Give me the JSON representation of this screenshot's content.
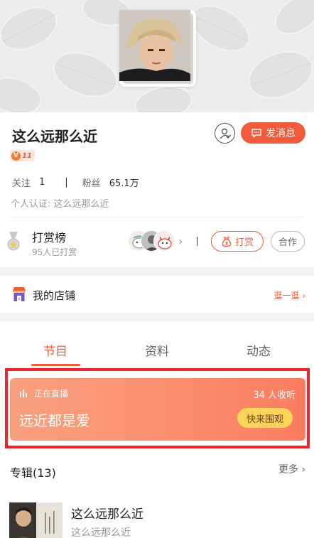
{
  "profile": {
    "name": "这么远那么近",
    "vip_level": "11",
    "follow_label": "关注",
    "follow_count": "1",
    "fans_label": "粉丝",
    "fans_count": "65.1万",
    "certification": "个人认证: 这么远那么近",
    "message_button": "发消息"
  },
  "reward": {
    "title": "打赏榜",
    "subtitle": "95人已打赏",
    "tip_button": "打赏",
    "coop_button": "合作"
  },
  "store": {
    "label": "我的店铺",
    "link": "逛一逛"
  },
  "tabs": [
    {
      "label": "节目",
      "active": true
    },
    {
      "label": "资料",
      "active": false
    },
    {
      "label": "动态",
      "active": false
    }
  ],
  "live": {
    "status": "正在直播",
    "listeners": "34 人收听",
    "title": "远近都是爱",
    "button": "快来围观"
  },
  "album": {
    "header": "专辑(13)",
    "more": "更多",
    "items": [
      {
        "name": "这么远那么近",
        "subtitle": "这么远那么近"
      }
    ]
  },
  "colors": {
    "accent": "#f15a3a",
    "live_highlight": "#e8272f",
    "live_button": "#fbd55a"
  },
  "icons": [
    "avatar",
    "follow-user-icon",
    "chat-bubble-icon",
    "medal-icon",
    "chevron-right-icon",
    "tip-bag-icon",
    "store-icon",
    "equalizer-icon"
  ]
}
